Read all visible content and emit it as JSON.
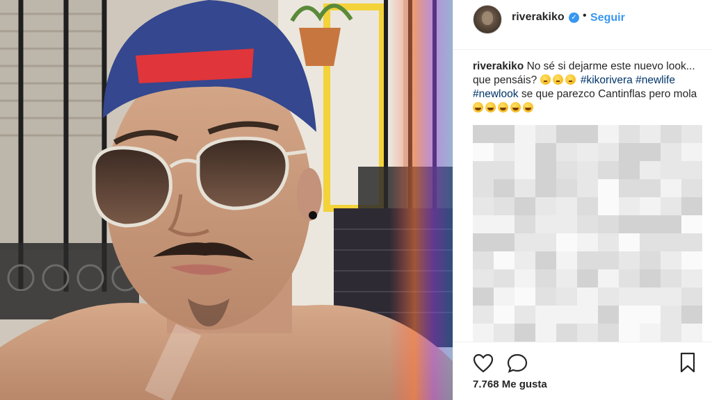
{
  "post": {
    "username": "riverakiko",
    "separator": "•",
    "follow_label": "Seguir",
    "caption": {
      "user": "riverakiko",
      "text_1": "No sé si dejarme este nuevo look... que pensáis?",
      "hashtags_1": "#kikorivera #newlife #newlook",
      "text_2": "se que parezco Cantinflas pero mola"
    },
    "likes": "7.768 Me gusta"
  },
  "icons": {
    "verified": "verified-badge-icon",
    "like": "heart-icon",
    "comment": "comment-bubble-icon",
    "save": "bookmark-icon"
  },
  "colors": {
    "accent": "#3897f0",
    "hashtag": "#003569",
    "text": "#262626",
    "border": "#efefef"
  }
}
